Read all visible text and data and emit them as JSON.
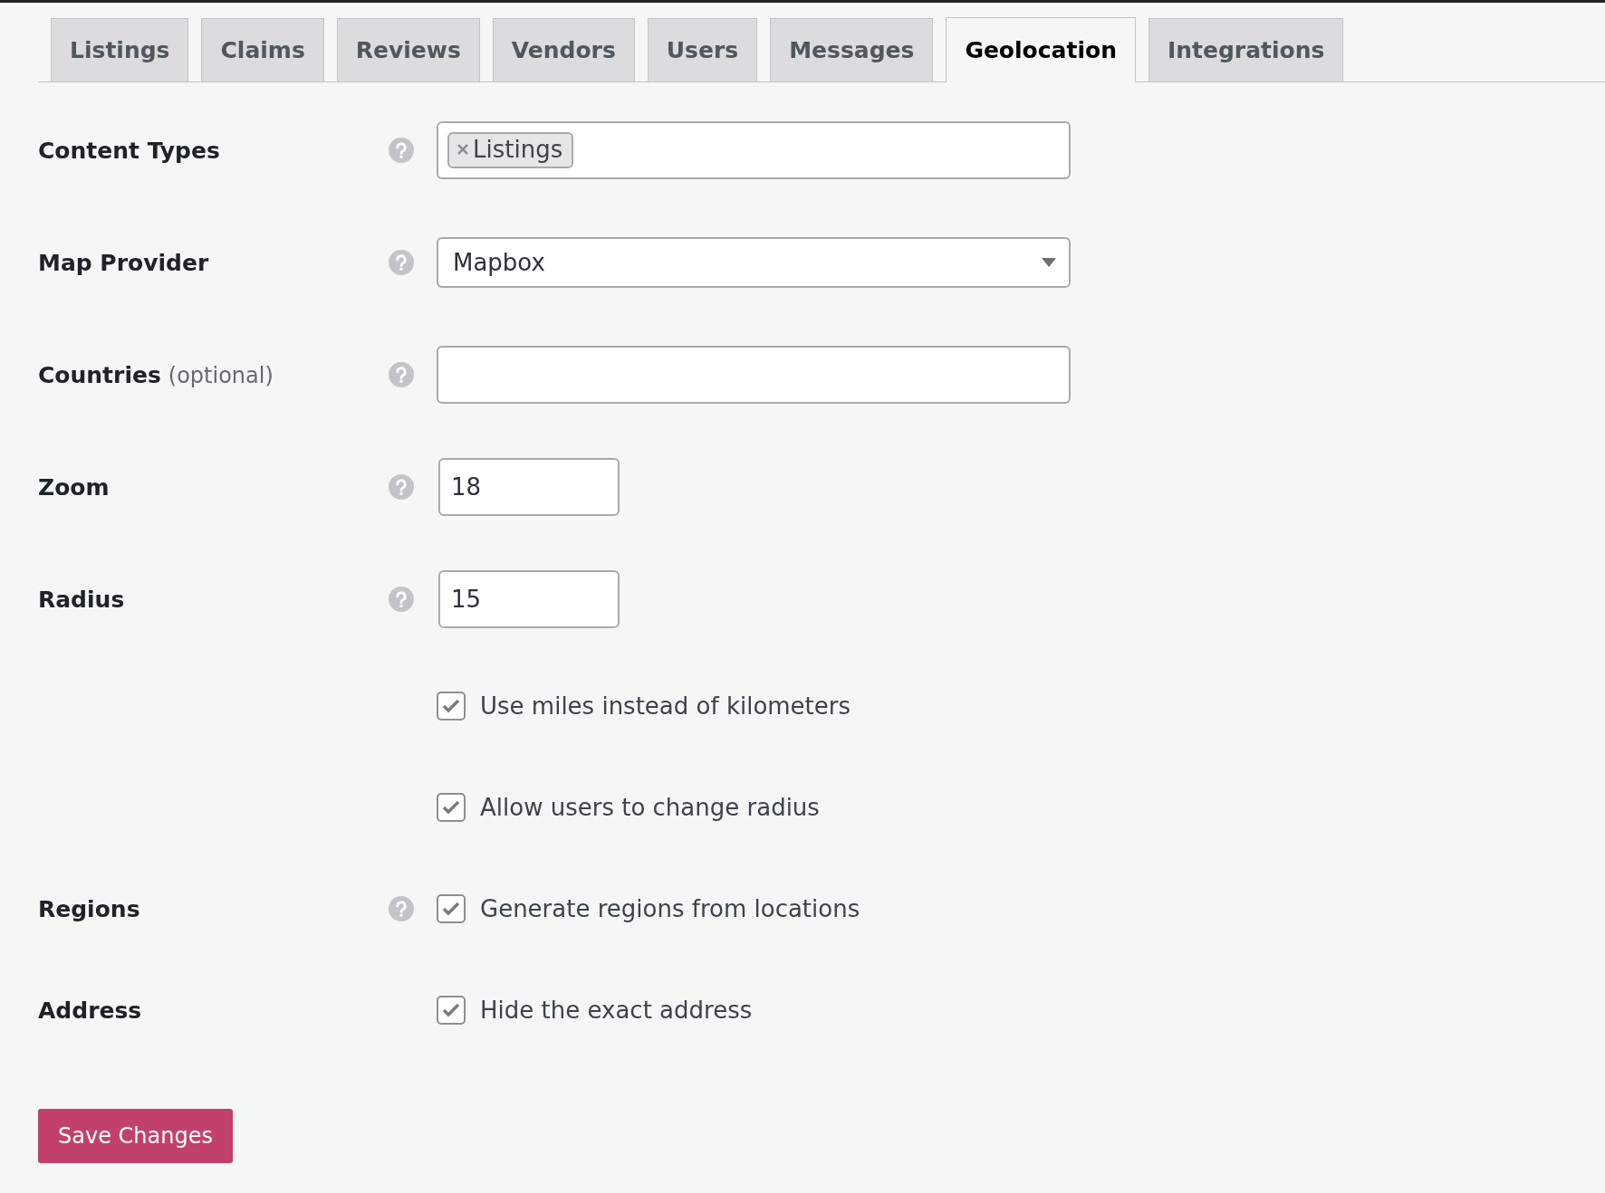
{
  "tabs": [
    {
      "label": "Listings",
      "selected": false
    },
    {
      "label": "Claims",
      "selected": false
    },
    {
      "label": "Reviews",
      "selected": false
    },
    {
      "label": "Vendors",
      "selected": false
    },
    {
      "label": "Users",
      "selected": false
    },
    {
      "label": "Messages",
      "selected": false
    },
    {
      "label": "Geolocation",
      "selected": true
    },
    {
      "label": "Integrations",
      "selected": false
    }
  ],
  "settings": [
    {
      "kind": "tags",
      "label": "Content Types",
      "help": true,
      "tags": [
        "Listings"
      ]
    },
    {
      "kind": "select",
      "label": "Map Provider",
      "help": true,
      "value": "Mapbox"
    },
    {
      "kind": "text",
      "label": "Countries",
      "note": "(optional)",
      "help": true
    },
    {
      "kind": "number",
      "label": "Zoom",
      "help": true,
      "value": "18"
    },
    {
      "kind": "number",
      "label": "Radius",
      "help": true,
      "value": "15"
    },
    {
      "kind": "checkbox",
      "help": false,
      "text": "Use miles instead of kilometers",
      "checked": true
    },
    {
      "kind": "checkbox",
      "help": false,
      "text": "Allow users to change radius",
      "checked": true
    },
    {
      "kind": "checkbox",
      "label": "Regions",
      "help": true,
      "text": "Generate regions from locations",
      "checked": true
    },
    {
      "kind": "checkbox",
      "label": "Address",
      "help": false,
      "text": "Hide the exact address",
      "checked": true
    }
  ],
  "save_button": "Save Changes"
}
